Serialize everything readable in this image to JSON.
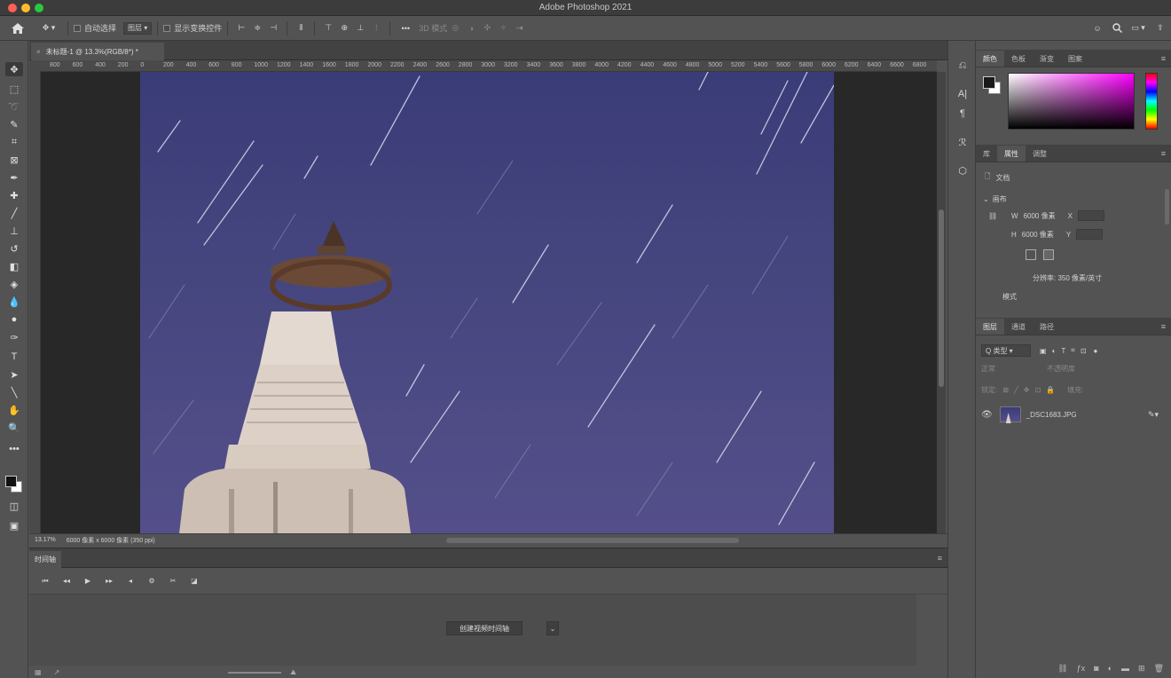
{
  "window": {
    "title": "Adobe Photoshop 2021"
  },
  "options_bar": {
    "auto_select_label": "自动选择",
    "layer_select_value": "图层",
    "show_transform_label": "显示变换控件",
    "more_label": "•••",
    "mode_3d_label": "3D 模式"
  },
  "document": {
    "tab_title": "未标题-1 @ 13.3%(RGB/8*) *",
    "ruler_marks": [
      "800",
      "600",
      "400",
      "200",
      "0",
      "200",
      "400",
      "600",
      "800",
      "1000",
      "1200",
      "1400",
      "1600",
      "1800",
      "2000",
      "2200",
      "2400",
      "2600",
      "2800",
      "3000",
      "3200",
      "3400",
      "3600",
      "3800",
      "4000",
      "4200",
      "4400",
      "4600",
      "4800",
      "5000",
      "5200",
      "5400",
      "5600",
      "5800",
      "6000",
      "6200",
      "6400",
      "6600",
      "6800"
    ],
    "zoom": "13.17%",
    "doc_info": "6000 像素 x 6000 像素 (350 ppi)"
  },
  "timeline": {
    "tab_label": "时间轴",
    "create_button_label": "创建视频时间轴"
  },
  "color_panel": {
    "tabs": [
      "颜色",
      "色板",
      "渐变",
      "图案"
    ]
  },
  "properties_panel": {
    "tabs": [
      "库",
      "属性",
      "调整"
    ],
    "section_label": "文档",
    "canvas_label": "画布",
    "width_label": "W",
    "width_value": "6000 像素",
    "height_label": "H",
    "height_value": "6000 像素",
    "x_label": "X",
    "y_label": "Y",
    "resolution_text": "分辨率: 350 像素/英寸",
    "mode_label": "模式"
  },
  "layers_panel": {
    "tabs": [
      "图层",
      "通道",
      "路径"
    ],
    "filter_value": "Q 类型",
    "blend_mode": "正常",
    "opacity_label": "不透明度",
    "lock_label": "锁定:",
    "fill_label": "填充:",
    "layer_name": "_DSC1683.JPG"
  }
}
